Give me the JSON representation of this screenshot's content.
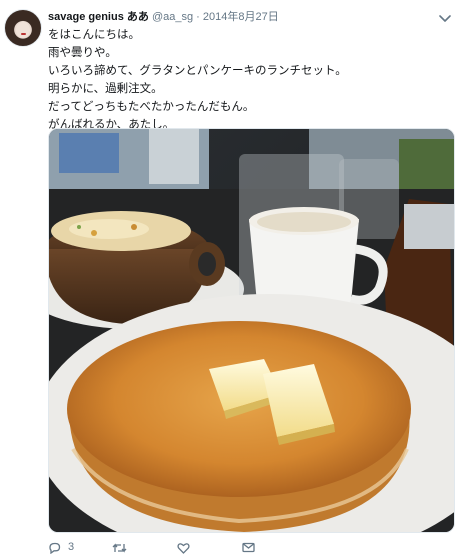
{
  "tweet": {
    "display_name": "savage genius ああ",
    "handle": "@aa_sg",
    "separator": "·",
    "date": "2014年8月27日",
    "lines": [
      "をはこんにちは。",
      "雨や曇りや。",
      "いろいろ諦めて、グラタンとパンケーキのランチセット。",
      "明らかに、過剰注文。",
      "だってどっちもたべたかったんだもん。",
      "がんばれるか、あたし。"
    ],
    "photo": {
      "subject": "pancake-with-butter-gratin-coffee"
    }
  },
  "actions": {
    "reply_count": "3",
    "retweet_count": "",
    "like_count": "",
    "icons": [
      "reply-icon",
      "retweet-icon",
      "like-icon",
      "message-icon"
    ]
  },
  "colors": {
    "text": "#14171a",
    "muted": "#657786",
    "border": "#e1e8ed"
  }
}
